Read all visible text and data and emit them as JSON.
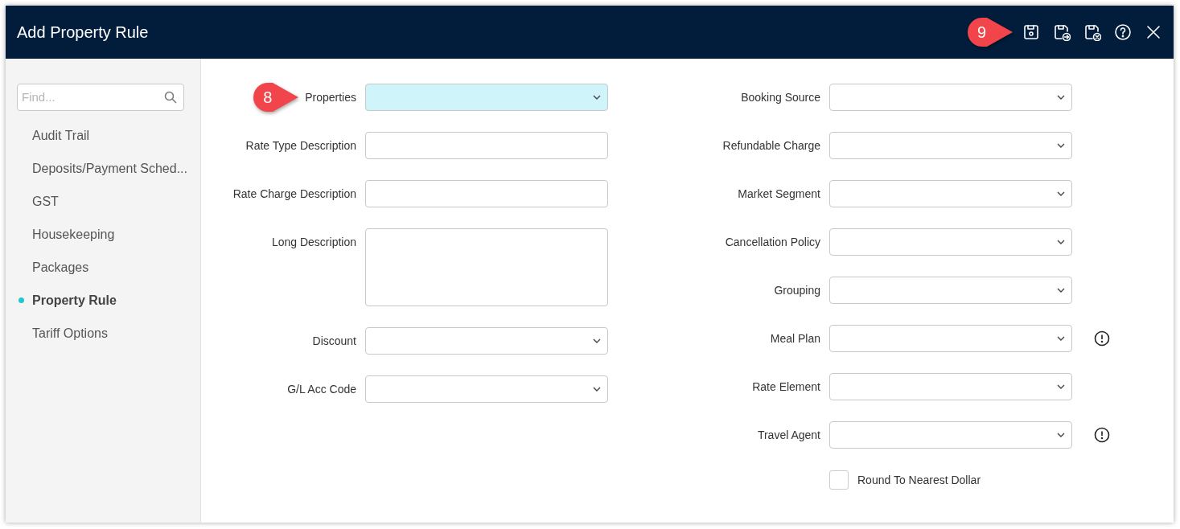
{
  "window": {
    "title": "Add Property Rule"
  },
  "toolbar": [
    {
      "kind": "save",
      "callout": "9"
    },
    {
      "kind": "save-next"
    },
    {
      "kind": "save-close"
    },
    {
      "kind": "help"
    },
    {
      "kind": "close"
    }
  ],
  "sidebar": {
    "search": {
      "placeholder": "Find..."
    },
    "items": [
      {
        "label": "Audit Trail",
        "selected": false
      },
      {
        "label": "Deposits/Payment Sched...",
        "selected": false
      },
      {
        "label": "GST",
        "selected": false
      },
      {
        "label": "Housekeeping",
        "selected": false
      },
      {
        "label": "Packages",
        "selected": false
      },
      {
        "label": "Property Rule",
        "selected": true
      },
      {
        "label": "Tariff Options",
        "selected": false
      }
    ]
  },
  "form": {
    "left": [
      {
        "label": "Properties",
        "kind": "select",
        "highlighted": true,
        "callout": "8"
      },
      {
        "label": "Rate Type Description",
        "kind": "text",
        "highlighted": false
      },
      {
        "label": "Rate Charge Description",
        "kind": "text",
        "highlighted": false
      },
      {
        "label": "Long Description",
        "kind": "textarea",
        "highlighted": false
      },
      {
        "label": "Discount",
        "kind": "select",
        "highlighted": false
      },
      {
        "label": "G/L Acc Code",
        "kind": "select",
        "highlighted": false
      }
    ],
    "right": [
      {
        "label": "Booking Source",
        "kind": "select",
        "info": false
      },
      {
        "label": "Refundable Charge",
        "kind": "select",
        "info": false
      },
      {
        "label": "Market Segment",
        "kind": "select",
        "info": false
      },
      {
        "label": "Cancellation Policy",
        "kind": "select",
        "info": false
      },
      {
        "label": "Grouping",
        "kind": "select",
        "info": false
      },
      {
        "label": "Meal Plan",
        "kind": "select",
        "info": true
      },
      {
        "label": "Rate Element",
        "kind": "select",
        "info": false
      },
      {
        "label": "Travel Agent",
        "kind": "select",
        "info": true
      }
    ],
    "checkbox": {
      "label": "Round To Nearest Dollar",
      "checked": false
    }
  }
}
